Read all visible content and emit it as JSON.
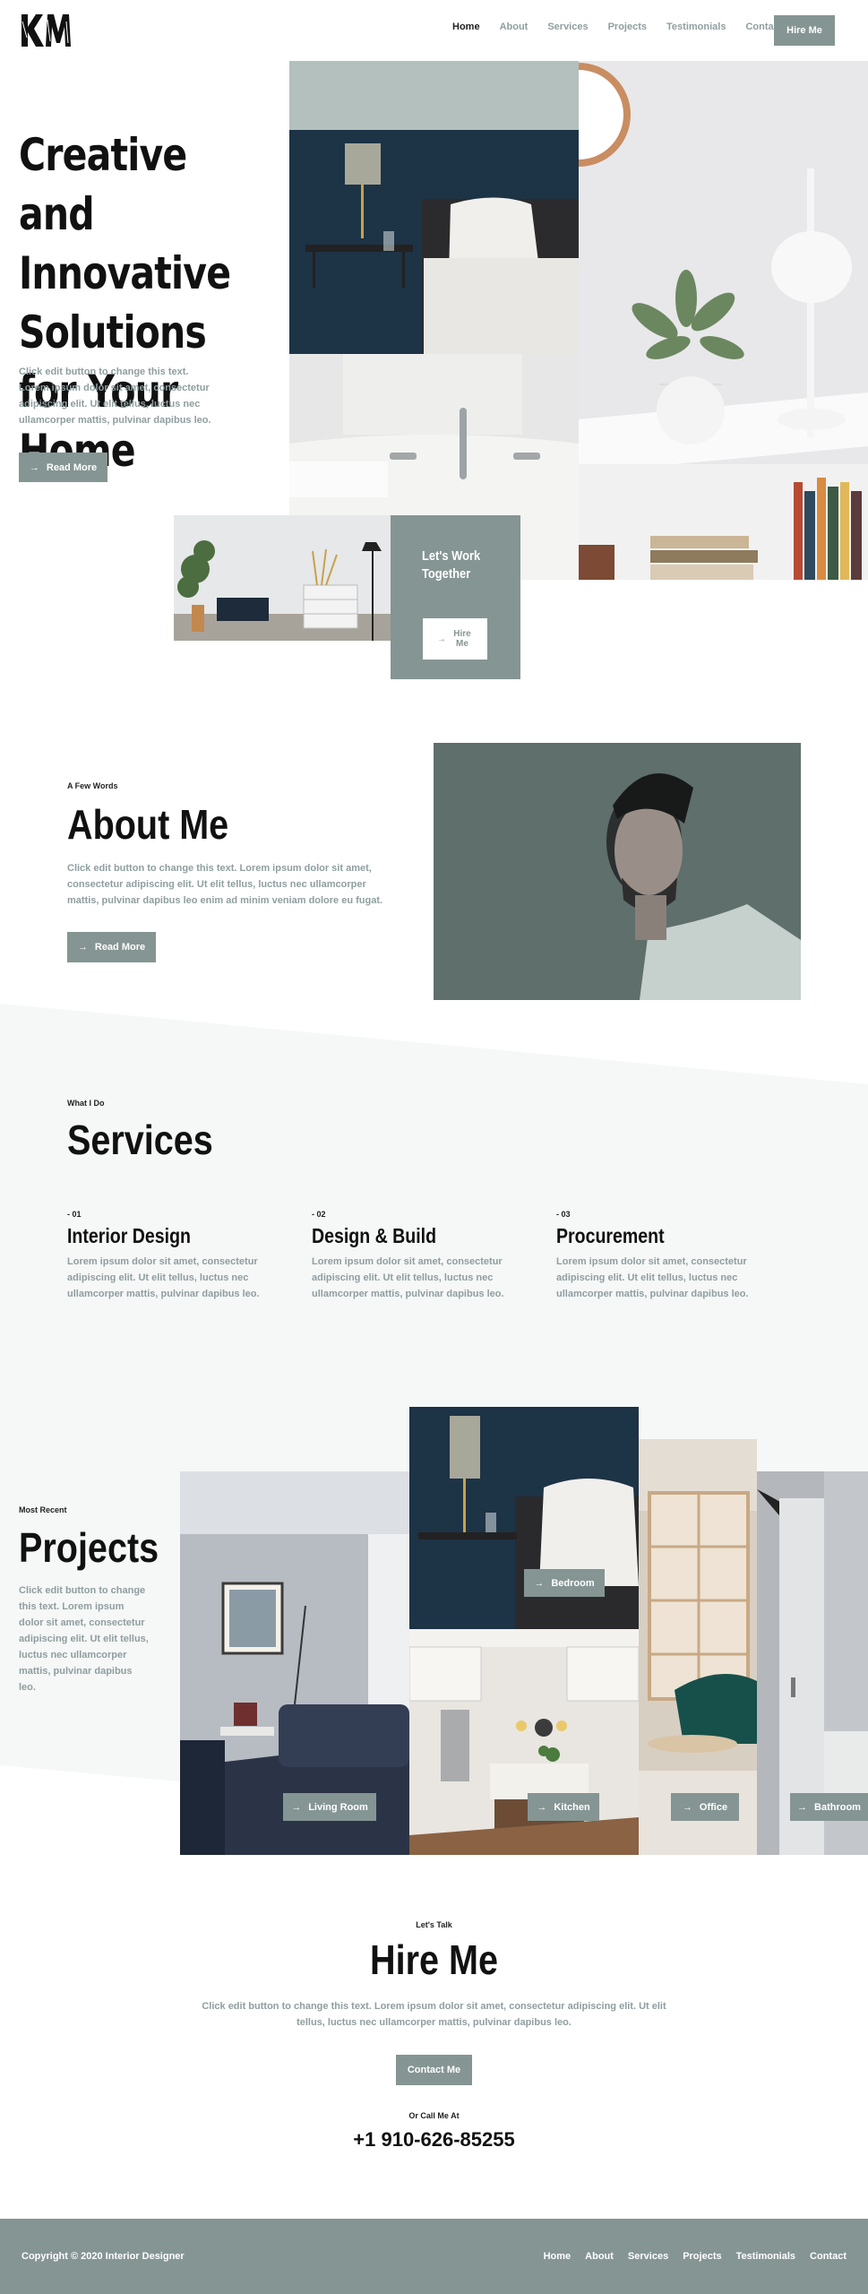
{
  "header": {
    "logo_text": "KM",
    "nav": [
      "Home",
      "About",
      "Services",
      "Projects",
      "Testimonials",
      "Contact"
    ],
    "active_nav": "Home",
    "hire_label": "Hire Me"
  },
  "hero": {
    "title": "Creative and Innovative Solutions for Your Home",
    "text": "Click edit button to change this text. Lorem ipsum dolor sit amet, consectetur adipiscing elit. Ut elit tellus, luctus nec ullamcorper mattis, pulvinar dapibus leo.",
    "button": "Read More",
    "work_card_title": "Let's Work Together",
    "work_card_button": "Hire Me"
  },
  "about": {
    "kicker": "A Few Words",
    "title": "About Me",
    "text": "Click edit button to change this text. Lorem ipsum dolor sit amet, consectetur adipiscing elit. Ut elit tellus, luctus nec ullamcorper mattis, pulvinar dapibus leo enim ad minim veniam dolore eu fugat.",
    "button": "Read More"
  },
  "services": {
    "kicker": "What I Do",
    "title": "Services",
    "items": [
      {
        "num": "- 01",
        "title": "Interior Design",
        "text": "Lorem ipsum dolor sit amet, consectetur adipiscing elit. Ut elit tellus, luctus nec ullamcorper mattis, pulvinar dapibus leo."
      },
      {
        "num": "- 02",
        "title": "Design & Build",
        "text": "Lorem ipsum dolor sit amet, consectetur adipiscing elit. Ut elit tellus, luctus nec ullamcorper mattis, pulvinar dapibus leo."
      },
      {
        "num": "- 03",
        "title": "Procurement",
        "text": "Lorem ipsum dolor sit amet, consectetur adipiscing elit. Ut elit tellus, luctus nec ullamcorper mattis, pulvinar dapibus leo."
      }
    ]
  },
  "projects": {
    "kicker": "Most Recent",
    "title": "Projects",
    "text": "Click edit button to change this text. Lorem ipsum dolor sit amet, consectetur adipiscing elit. Ut elit tellus, luctus nec ullamcorper mattis, pulvinar dapibus leo.",
    "buttons": [
      "Bedroom",
      "Living Room",
      "Kitchen",
      "Office",
      "Bathroom"
    ]
  },
  "hire": {
    "kicker": "Let's Talk",
    "title": "Hire Me",
    "text": "Click edit button to change this text. Lorem ipsum dolor sit amet, consectetur adipiscing elit. Ut elit tellus, luctus nec ullamcorper mattis, pulvinar dapibus leo.",
    "button": "Contact Me",
    "call_label": "Or Call Me At",
    "phone": "+1 910-626-85255"
  },
  "footer": {
    "copyright": "Copyright © 2020 Interior Designer",
    "nav": [
      "Home",
      "About",
      "Services",
      "Projects",
      "Testimonials",
      "Contact"
    ]
  },
  "colors": {
    "accent": "#859593",
    "muted_text": "#8f9ea0",
    "dark": "#111111"
  },
  "icons": {
    "arrow": "arrow-right-icon"
  }
}
